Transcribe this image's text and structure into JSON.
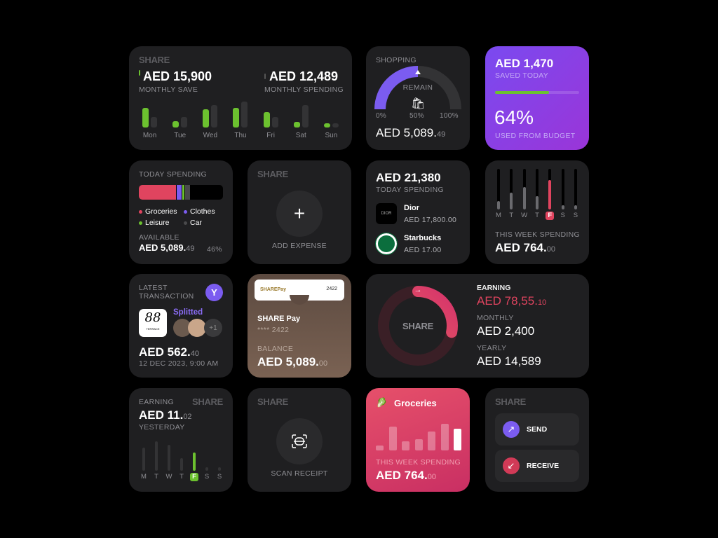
{
  "colors": {
    "card": "#1f1f21",
    "green": "#6cc12f",
    "purple": "#7b5cf0",
    "pink": "#e0445f",
    "gray": "#3a3a3c"
  },
  "monthly": {
    "brand": "SHARE",
    "save_amount": "AED 15,900",
    "save_label": "MONTHLY SAVE",
    "spend_amount": "AED 12,489",
    "spend_label": "MONTHLY SPENDING",
    "days": [
      {
        "d": "Mon",
        "save": 0.75,
        "spend": 0.4
      },
      {
        "d": "Tue",
        "save": 0.25,
        "spend": 0.4
      },
      {
        "d": "Wed",
        "save": 0.7,
        "spend": 0.86
      },
      {
        "d": "Thu",
        "save": 0.75,
        "spend": 1.0
      },
      {
        "d": "Fri",
        "save": 0.6,
        "spend": 0.4
      },
      {
        "d": "Sat",
        "save": 0.22,
        "spend": 0.86
      },
      {
        "d": "Sun",
        "save": 0.16,
        "spend": 0.16
      }
    ]
  },
  "shopping": {
    "title": "SHOPPING",
    "remain": "REMAIN",
    "icon": "shopping-bags-icon",
    "progress": 0.5,
    "min": "0%",
    "mid": "50%",
    "max": "100%",
    "amount": "AED 5,089.",
    "cents": "49"
  },
  "saved": {
    "amount": "AED 1,470",
    "label": "SAVED TODAY",
    "progress": 0.64,
    "percent": "64%",
    "percent_label": "USED FROM BUDGET"
  },
  "today": {
    "title": "TODAY SPENDING",
    "segments": [
      {
        "name": "Groceries",
        "color": "#e0445f",
        "share": 0.45
      },
      {
        "name": "Clothes",
        "color": "#7b5cf0",
        "share": 0.07
      },
      {
        "name": "Leisure",
        "color": "#6cc12f",
        "share": 0.03
      },
      {
        "name": "Car",
        "color": "#4a4a4c",
        "share": 0.07
      }
    ],
    "available_label": "AVAILABLE",
    "available": "AED 5,089.",
    "available_cents": "49",
    "percent": "46%"
  },
  "add": {
    "brand": "SHARE",
    "label": "ADD EXPENSE"
  },
  "spending_list": {
    "amount": "AED 21,380",
    "label": "TODAY SPENDING",
    "items": [
      {
        "name": "Dior",
        "amount": "AED 17,800.00",
        "logo": "DIOR"
      },
      {
        "name": "Starbucks",
        "amount": "AED 17.00"
      }
    ]
  },
  "week": {
    "days": [
      "M",
      "T",
      "W",
      "T",
      "F",
      "S",
      "S"
    ],
    "levels": [
      0.2,
      0.42,
      0.55,
      0.32,
      0.73,
      0.1,
      0.1
    ],
    "active": 4,
    "label": "THIS WEEK SPENDING",
    "amount": "AED 764.",
    "cents": "00"
  },
  "latest": {
    "title1": "LATEST",
    "title2": "TRANSACTION",
    "merchant_logo": "88",
    "merchant_sub": "TERRACE",
    "splitted": "Splitted",
    "more": "+1",
    "amount": "AED 562.",
    "cents": "40",
    "date": "12 DEC 2023, 9:00 AM"
  },
  "card": {
    "logo": "SHAREPay",
    "number_short": "2422",
    "name": "SHARE Pay",
    "masked": "**** 2422",
    "balance_label": "BALANCE",
    "balance": "AED 5,089.",
    "cents": "00"
  },
  "earning": {
    "center": "SHARE",
    "progress": 0.28,
    "label": "EARNING",
    "amount": "AED 78,55.",
    "cents": "10",
    "monthly_label": "MONTHLY",
    "monthly": "AED 2,400",
    "yearly_label": "YEARLY",
    "yearly": "AED 14,589"
  },
  "yesterday": {
    "label": "EARNING",
    "brand": "SHARE",
    "amount": "AED 11.",
    "cents": "02",
    "sub": "YESTERDAY",
    "days": [
      "M",
      "T",
      "W",
      "T",
      "F",
      "S",
      "S"
    ],
    "levels": [
      0.75,
      0.95,
      0.85,
      0.4,
      0.6,
      0.12,
      0.12
    ],
    "active": 4
  },
  "scan": {
    "brand": "SHARE",
    "label": "SCAN RECEIPT"
  },
  "groceries": {
    "title": "Groceries",
    "levels": [
      0.15,
      0.75,
      0.3,
      0.35,
      0.6,
      0.85,
      0.7
    ],
    "label": "THIS WEEK SPENDING",
    "amount": "AED 764.",
    "cents": "00"
  },
  "transfer": {
    "brand": "SHARE",
    "send": "SEND",
    "receive": "RECEIVE"
  }
}
